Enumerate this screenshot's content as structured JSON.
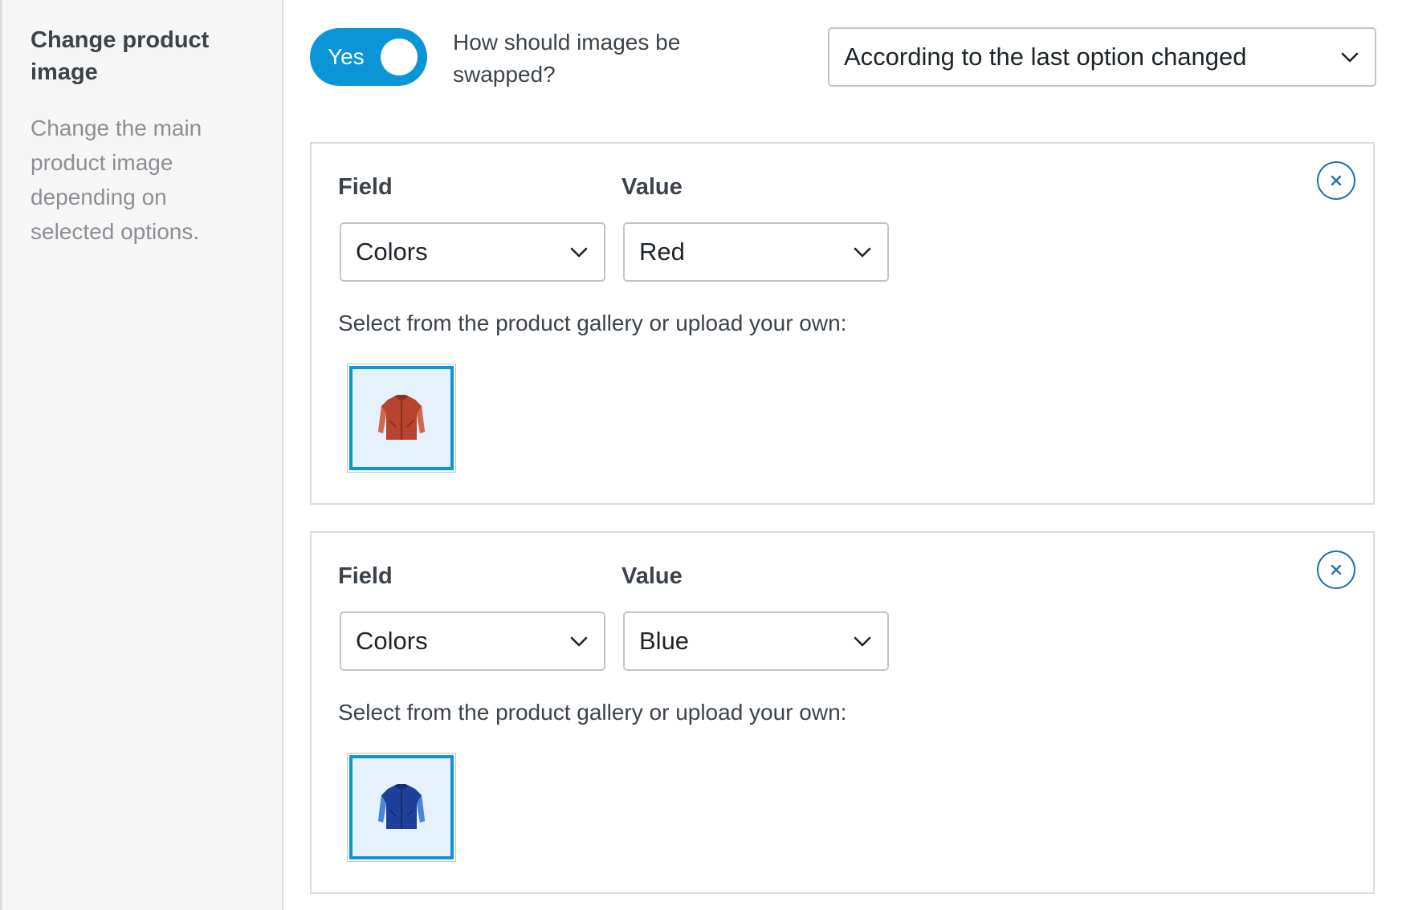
{
  "setting": {
    "title": "Change product image",
    "description": "Change the main product image depending on selected options."
  },
  "toggle": {
    "label": "Yes",
    "enabled": true,
    "color": "#0a96d6"
  },
  "swap": {
    "question": "How should images be swapped?",
    "selected": "According to the last option changed"
  },
  "rules": [
    {
      "field_label": "Field",
      "value_label": "Value",
      "field_selected": "Colors",
      "value_selected": "Red",
      "gallery_hint": "Select from the product gallery or upload your own:",
      "thumbnail_icon": "red-jacket-icon",
      "jacket_color": "#b8432f"
    },
    {
      "field_label": "Field",
      "value_label": "Value",
      "field_selected": "Colors",
      "value_selected": "Blue",
      "gallery_hint": "Select from the product gallery or upload your own:",
      "thumbnail_icon": "blue-jacket-icon",
      "jacket_color": "#1e3f9a"
    }
  ],
  "icons": {
    "chevron": "chevron-down-icon",
    "remove": "close-icon"
  }
}
